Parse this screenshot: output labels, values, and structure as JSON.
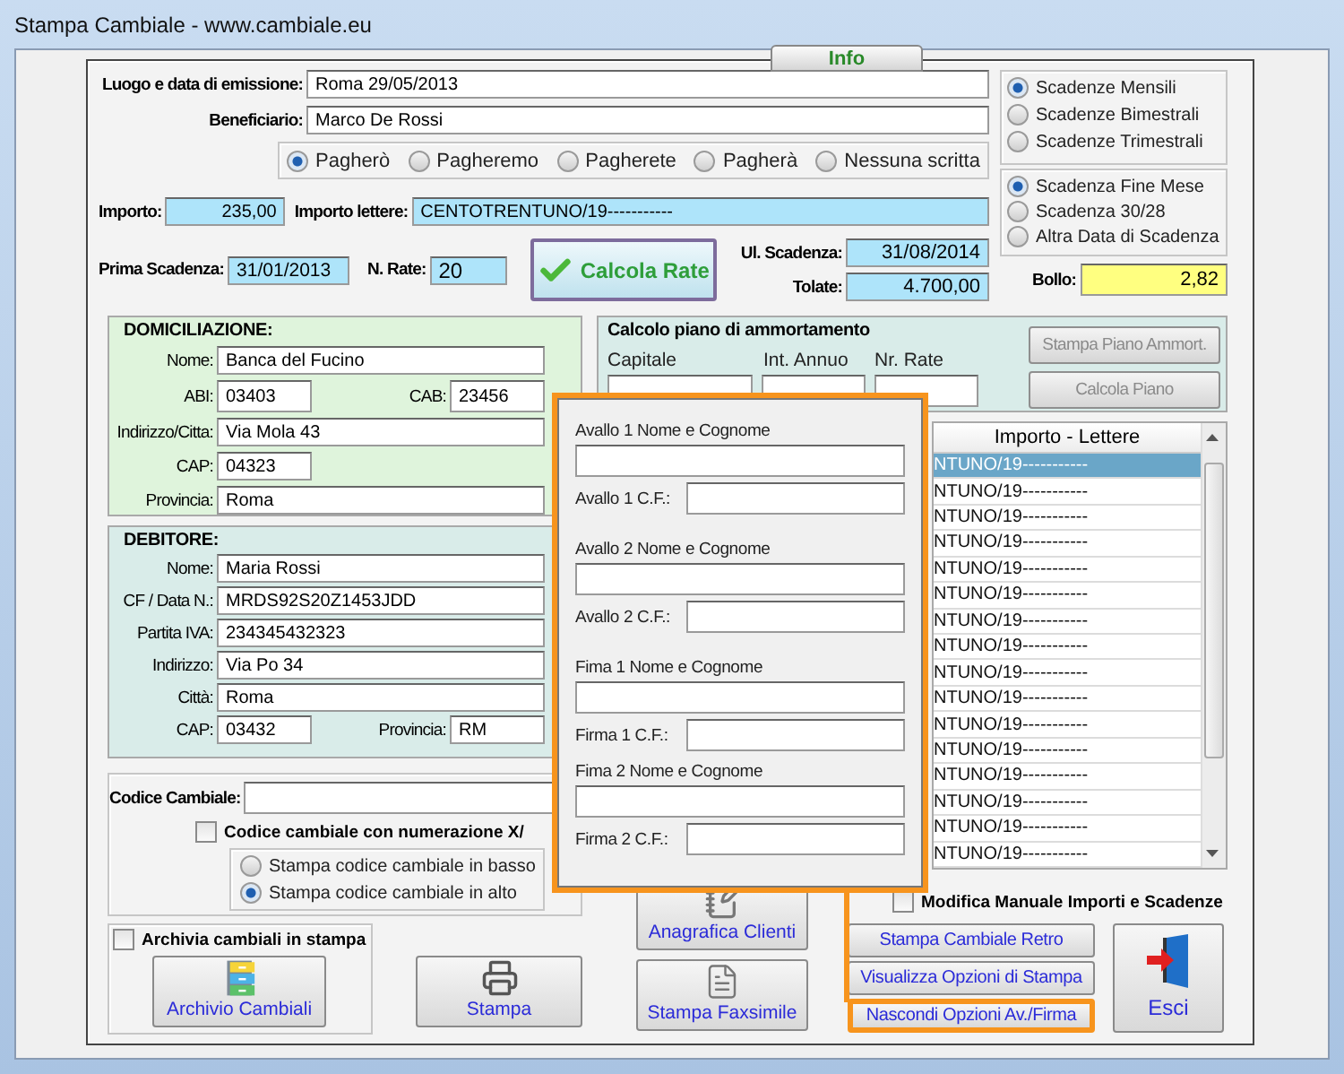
{
  "window": {
    "title": "Stampa Cambiale - www.cambiale.eu"
  },
  "tab": {
    "label": "Info"
  },
  "emission": {
    "label": "Luogo e data di emissione:",
    "value": "Roma 29/05/2013"
  },
  "beneficiary": {
    "label": "Beneficiario:",
    "value": "Marco De Rossi"
  },
  "promise_options": [
    {
      "label": "Pagherò",
      "selected": true
    },
    {
      "label": "Pagheremo",
      "selected": false
    },
    {
      "label": "Pagherete",
      "selected": false
    },
    {
      "label": "Pagherà",
      "selected": false
    },
    {
      "label": "Nessuna scritta",
      "selected": false
    }
  ],
  "amount": {
    "label": "Importo:",
    "value": "235,00"
  },
  "amount_words": {
    "label": "Importo lettere:",
    "value": "CENTOTRENTUNO/19-----------"
  },
  "first_due": {
    "label": "Prima Scadenza:",
    "value": "31/01/2013"
  },
  "installments": {
    "label": "N. Rate:",
    "value": "20"
  },
  "calc_button": {
    "label": "Calcola Rate"
  },
  "last_due": {
    "label": "Ul. Scadenza:",
    "value": "31/08/2014"
  },
  "total": {
    "label": "Tolate:",
    "value": "4.700,00"
  },
  "frequency_options": [
    {
      "label": "Scadenze Mensili",
      "selected": true
    },
    {
      "label": "Scadenze Bimestrali",
      "selected": false
    },
    {
      "label": "Scadenze Trimestrali",
      "selected": false
    }
  ],
  "due_options": [
    {
      "label": "Scadenza Fine Mese",
      "selected": true
    },
    {
      "label": "Scadenza 30/28",
      "selected": false
    },
    {
      "label": "Altra Data di Scadenza",
      "selected": false
    }
  ],
  "stamp_duty": {
    "label": "Bollo:",
    "value": "2,82"
  },
  "domiciliation": {
    "title": "DOMICILIAZIONE:",
    "rows": [
      [
        {
          "label": "Nome:",
          "value": "Banca del Fucino"
        }
      ],
      [
        {
          "label": "ABI:",
          "value": "03403",
          "kind": "short"
        },
        {
          "label": "CAB:",
          "value": "23456",
          "kind": "short"
        }
      ],
      [
        {
          "label": "Indirizzo/Citta:",
          "value": "Via Mola 43"
        }
      ],
      [
        {
          "label": "CAP:",
          "value": "04323",
          "kind": "short"
        }
      ],
      [
        {
          "label": "Provincia:",
          "value": "Roma"
        }
      ]
    ]
  },
  "debtor": {
    "title": "DEBITORE:",
    "rows": [
      [
        {
          "label": "Nome:",
          "value": "Maria Rossi"
        }
      ],
      [
        {
          "label": "CF / Data N.:",
          "value": "MRDS92S20Z1453JDD"
        }
      ],
      [
        {
          "label": "Partita IVA:",
          "value": "234345432323"
        }
      ],
      [
        {
          "label": "Indirizzo:",
          "value": "Via Po 34"
        }
      ],
      [
        {
          "label": "Città:",
          "value": "Roma"
        }
      ],
      [
        {
          "label": "CAP:",
          "value": "03432",
          "kind": "short"
        },
        {
          "label": "Provincia:",
          "value": "RM",
          "kind": "short"
        }
      ]
    ]
  },
  "code": {
    "label": "Codice Cambiale:",
    "numbering": {
      "label": "Codice cambiale con numerazione X/",
      "checked": false
    },
    "position_options": [
      {
        "label": "Stampa codice cambiale in basso",
        "selected": false
      },
      {
        "label": "Stampa codice cambiale in alto",
        "selected": true
      }
    ]
  },
  "archive": {
    "label": "Archivia cambiali in stampa",
    "checked": false
  },
  "plan": {
    "title": "Calcolo piano di ammortamento",
    "fields": [
      "Capitale",
      "Int. Annuo",
      "Nr. Rate"
    ],
    "buttons": [
      {
        "label": "Stampa Piano Ammort.",
        "disabled": true
      },
      {
        "label": "Calcola Piano",
        "disabled": true
      }
    ]
  },
  "table": {
    "column": "Importo - Lettere",
    "rows": [
      {
        "text": "NTUNO/19-----------",
        "selected": true
      },
      {
        "text": "NTUNO/19-----------",
        "selected": false
      },
      {
        "text": "NTUNO/19-----------",
        "selected": false
      },
      {
        "text": "NTUNO/19-----------",
        "selected": false
      },
      {
        "text": "NTUNO/19-----------",
        "selected": false
      },
      {
        "text": "NTUNO/19-----------",
        "selected": false
      },
      {
        "text": "NTUNO/19-----------",
        "selected": false
      },
      {
        "text": "NTUNO/19-----------",
        "selected": false
      },
      {
        "text": "NTUNO/19-----------",
        "selected": false
      },
      {
        "text": "NTUNO/19-----------",
        "selected": false
      },
      {
        "text": "NTUNO/19-----------",
        "selected": false
      },
      {
        "text": "NTUNO/19-----------",
        "selected": false
      },
      {
        "text": "NTUNO/19-----------",
        "selected": false
      },
      {
        "text": "NTUNO/19-----------",
        "selected": false
      },
      {
        "text": "NTUNO/19-----------",
        "selected": false
      },
      {
        "text": "NTUNO/19-----------",
        "selected": false
      }
    ]
  },
  "manual_edit": {
    "label": "Modifica Manuale Importi e Scadenze",
    "checked": false
  },
  "icon_buttons": [
    {
      "kind": "archive",
      "label": "Archivio Cambiali"
    },
    {
      "kind": "print",
      "label": "Stampa"
    },
    {
      "kind": "clients",
      "label": "Anagrafica Clienti"
    },
    {
      "kind": "fax",
      "label": "Stampa Faxsimile"
    }
  ],
  "option_buttons": [
    {
      "label": "Stampa Cambiale Retro",
      "highlighted": false
    },
    {
      "label": "Visualizza Opzioni di Stampa",
      "highlighted": false
    },
    {
      "label": "Nascondi Opzioni Av./Firma",
      "highlighted": true
    }
  ],
  "exit_button": {
    "label": "Esci"
  },
  "signature_popup": {
    "fields": [
      {
        "kind": "stacked",
        "label": "Avallo 1 Nome e Cognome"
      },
      {
        "kind": "inline",
        "label": "Avallo 1 C.F.:"
      },
      {
        "kind": "stacked",
        "label": "Avallo 2 Nome e Cognome"
      },
      {
        "kind": "inline",
        "label": "Avallo 2 C.F.:"
      },
      {
        "kind": "stacked",
        "label": "Fima 1 Nome e Cognome"
      },
      {
        "kind": "inline",
        "label": "Firma 1 C.F.:"
      },
      {
        "kind": "stacked",
        "label": "Fima 2 Nome e Cognome"
      },
      {
        "kind": "inline",
        "label": "Firma 2 C.F.:"
      }
    ]
  }
}
